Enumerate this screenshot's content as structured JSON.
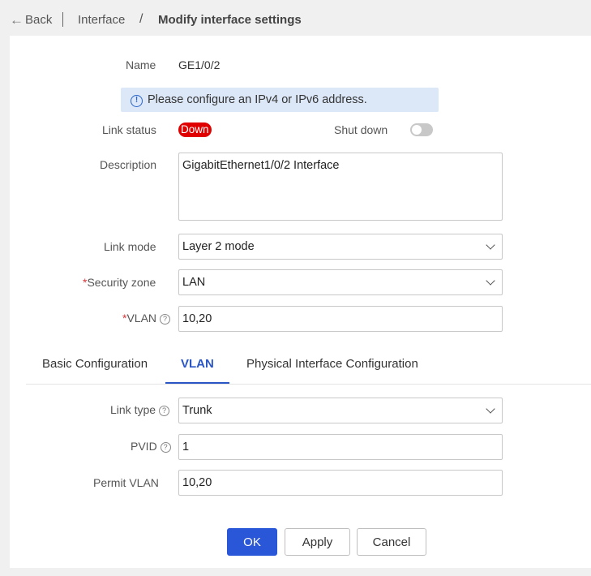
{
  "header": {
    "back_label": "Back",
    "breadcrumb_parent": "Interface",
    "breadcrumb_separator": "/",
    "page_title": "Modify interface settings"
  },
  "form": {
    "name_label": "Name",
    "name_value": "GE1/0/2",
    "notice": "Please configure an IPv4 or IPv6 address.",
    "link_status_label": "Link status",
    "link_status_value": "Down",
    "shut_down_label": "Shut down",
    "shut_down_on": false,
    "description_label": "Description",
    "description_value": "GigabitEthernet1/0/2 Interface",
    "link_mode_label": "Link mode",
    "link_mode_value": "Layer 2 mode",
    "security_zone_label": "Security zone",
    "security_zone_value": "LAN",
    "vlan_label": "VLAN",
    "vlan_value": "10,20",
    "required_mark": "*"
  },
  "tabs": [
    {
      "label": "Basic Configuration",
      "active": false
    },
    {
      "label": "VLAN",
      "active": true
    },
    {
      "label": "Physical Interface Configuration",
      "active": false
    }
  ],
  "vlan_tab": {
    "link_type_label": "Link type",
    "link_type_value": "Trunk",
    "pvid_label": "PVID",
    "pvid_value": "1",
    "permit_vlan_label": "Permit VLAN",
    "permit_vlan_value": "10,20"
  },
  "buttons": {
    "ok": "OK",
    "apply": "Apply",
    "cancel": "Cancel"
  },
  "colors": {
    "primary": "#2a56d8",
    "status_down": "#e00000",
    "notice_bg": "#dce8f8"
  }
}
